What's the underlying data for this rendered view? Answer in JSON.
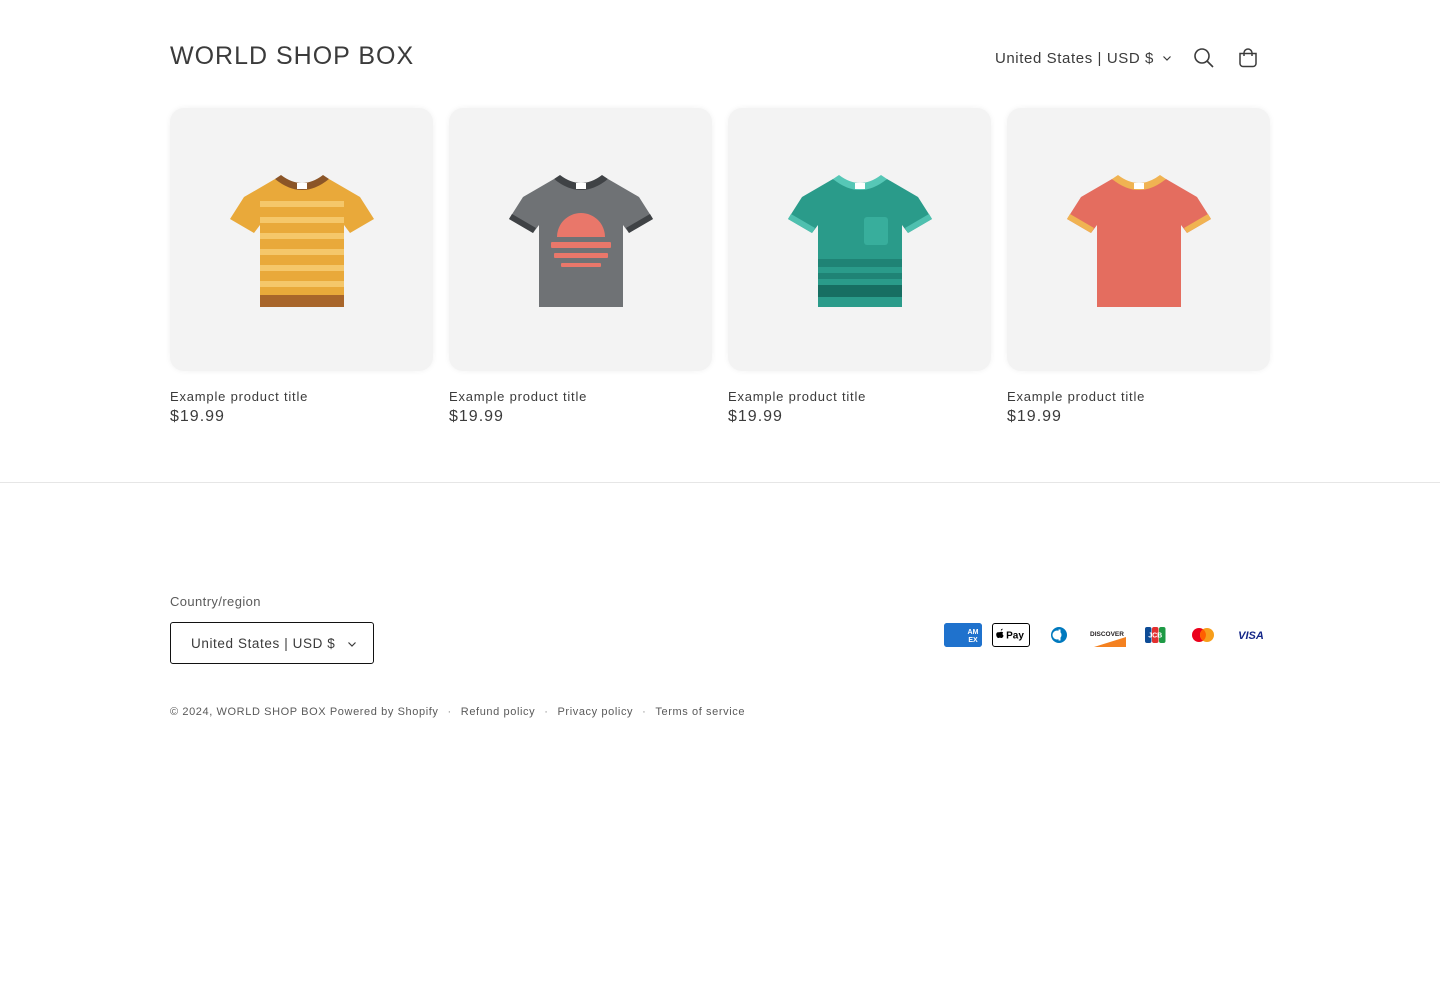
{
  "header": {
    "logo": "WORLD SHOP BOX",
    "localization": "United States | USD $"
  },
  "icons": {
    "search": "search-icon",
    "cart": "cart-icon",
    "chevron": "chevron-down-icon"
  },
  "products": [
    {
      "title": "Example product title",
      "price": "$19.99",
      "image": "striped-orange-tshirt"
    },
    {
      "title": "Example product title",
      "price": "$19.99",
      "image": "gray-sunset-tshirt"
    },
    {
      "title": "Example product title",
      "price": "$19.99",
      "image": "teal-pocket-tshirt"
    },
    {
      "title": "Example product title",
      "price": "$19.99",
      "image": "red-tshirt"
    }
  ],
  "footer": {
    "country_label": "Country/region",
    "country_value": "United States | USD $",
    "payment_methods": [
      "American Express",
      "Apple Pay",
      "Diners Club",
      "Discover",
      "JCB",
      "Mastercard",
      "Visa"
    ],
    "payment_labels": {
      "amex": "AM EX",
      "applepay": "Pay",
      "discover": "DISCOVER",
      "jcb": "JCB",
      "visa": "VISA"
    },
    "copyright": "© 2024,",
    "store_link": "WORLD SHOP BOX",
    "powered": "Powered by Shopify",
    "separator": "·",
    "refund": "Refund policy",
    "privacy": "Privacy policy",
    "terms": "Terms of service"
  },
  "colors": {
    "orange_shirt": "#E9A93A",
    "gray_shirt": "#6F7275",
    "teal_shirt": "#2A9B8A",
    "red_shirt": "#E46D5F",
    "card_bg": "#F3F3F3"
  }
}
